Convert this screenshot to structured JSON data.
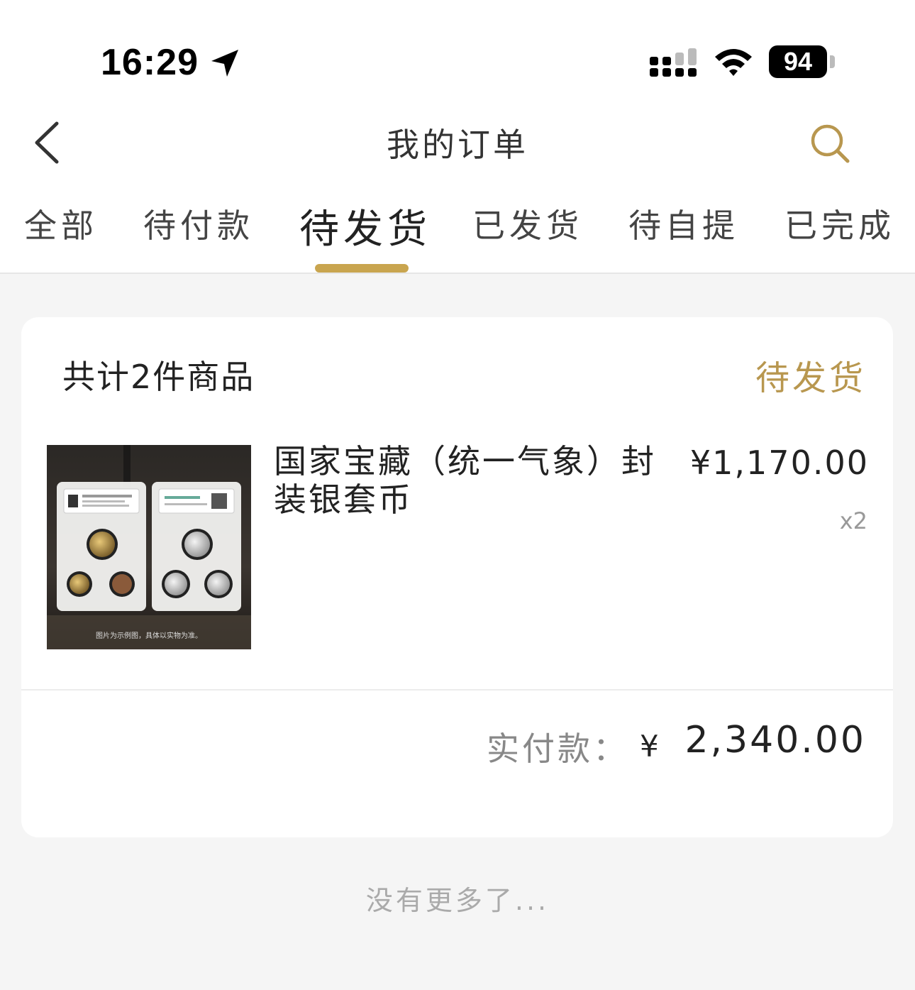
{
  "status_bar": {
    "time": "16:29",
    "battery": "94"
  },
  "header": {
    "title": "我的订单"
  },
  "tabs": [
    {
      "label": "全部"
    },
    {
      "label": "待付款"
    },
    {
      "label": "待发货",
      "active": true
    },
    {
      "label": "已发货"
    },
    {
      "label": "待自提"
    },
    {
      "label": "已完成"
    }
  ],
  "order": {
    "item_count_text": "共计2件商品",
    "status": "待发货",
    "product": {
      "name": "国家宝藏（统一气象）封装银套币",
      "unit_price": "¥1,170.00",
      "quantity": "x2",
      "image_caption": "图片为示例图，具体以实物为准。"
    },
    "total_label": "实付款：",
    "total_currency": "¥",
    "total_amount": "2,340.00"
  },
  "footer": {
    "no_more_text": "没有更多了..."
  },
  "colors": {
    "accent": "#c9a54f",
    "status_text": "#b8974f",
    "background": "#f5f5f5"
  }
}
